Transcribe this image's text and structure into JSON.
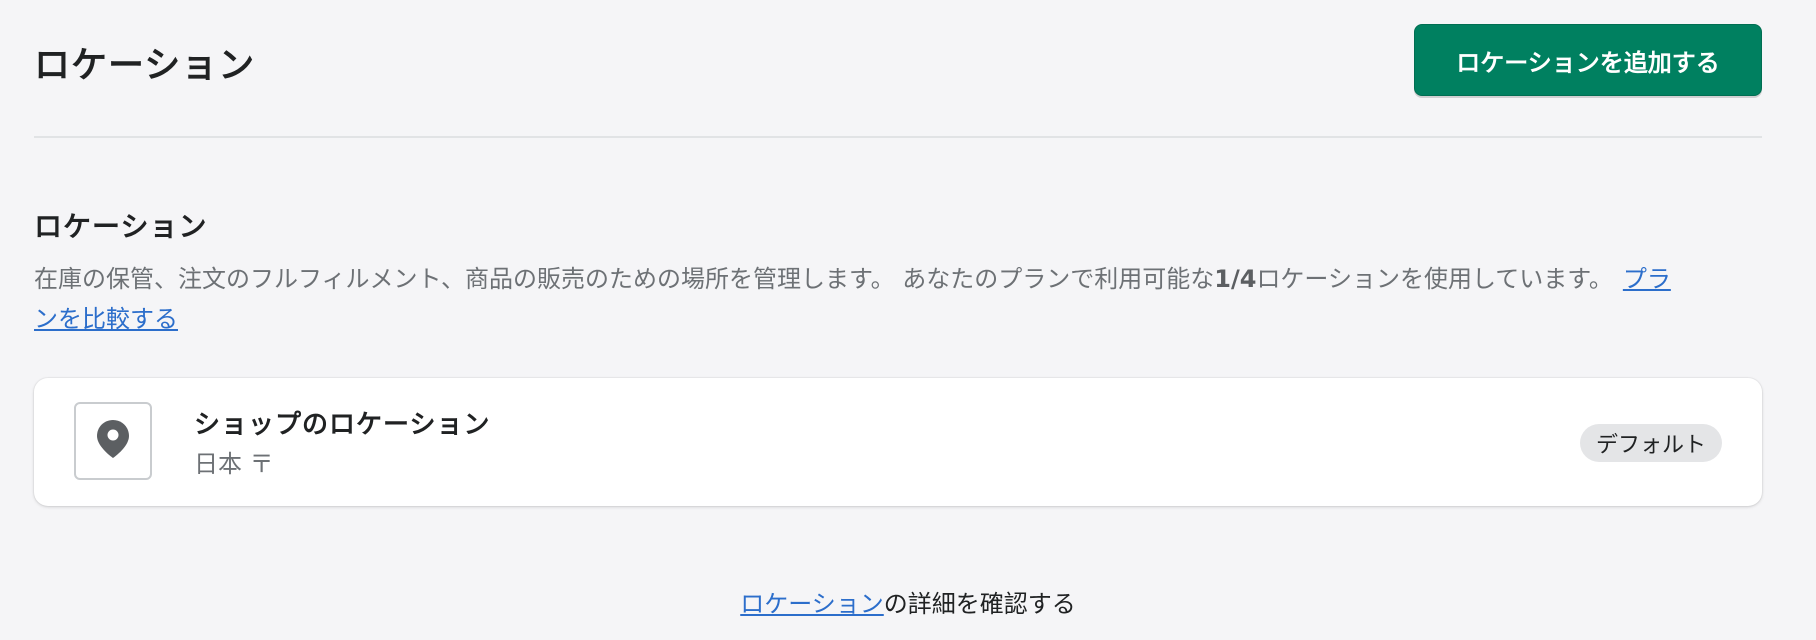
{
  "header": {
    "title": "ロケーション",
    "add_button_label": "ロケーションを追加する"
  },
  "section": {
    "title": "ロケーション",
    "description_prefix": "在庫の保管、注文のフルフィルメント、商品の販売のための場所を管理します。 あなたのプランで利用可能な",
    "usage_count": "1/4",
    "description_suffix": "ロケーションを使用しています。",
    "compare_link": "プランを比較する"
  },
  "location_card": {
    "icon": "map-pin-icon",
    "name": "ショップのロケーション",
    "address": "日本 〒",
    "badge": "デフォルト"
  },
  "footer": {
    "link_text": "ロケーション",
    "suffix": "の詳細を確認する"
  },
  "colors": {
    "primary": "#008060",
    "link": "#2c6ecb",
    "background": "#f5f5f7",
    "badge_bg": "#e4e5e7"
  }
}
